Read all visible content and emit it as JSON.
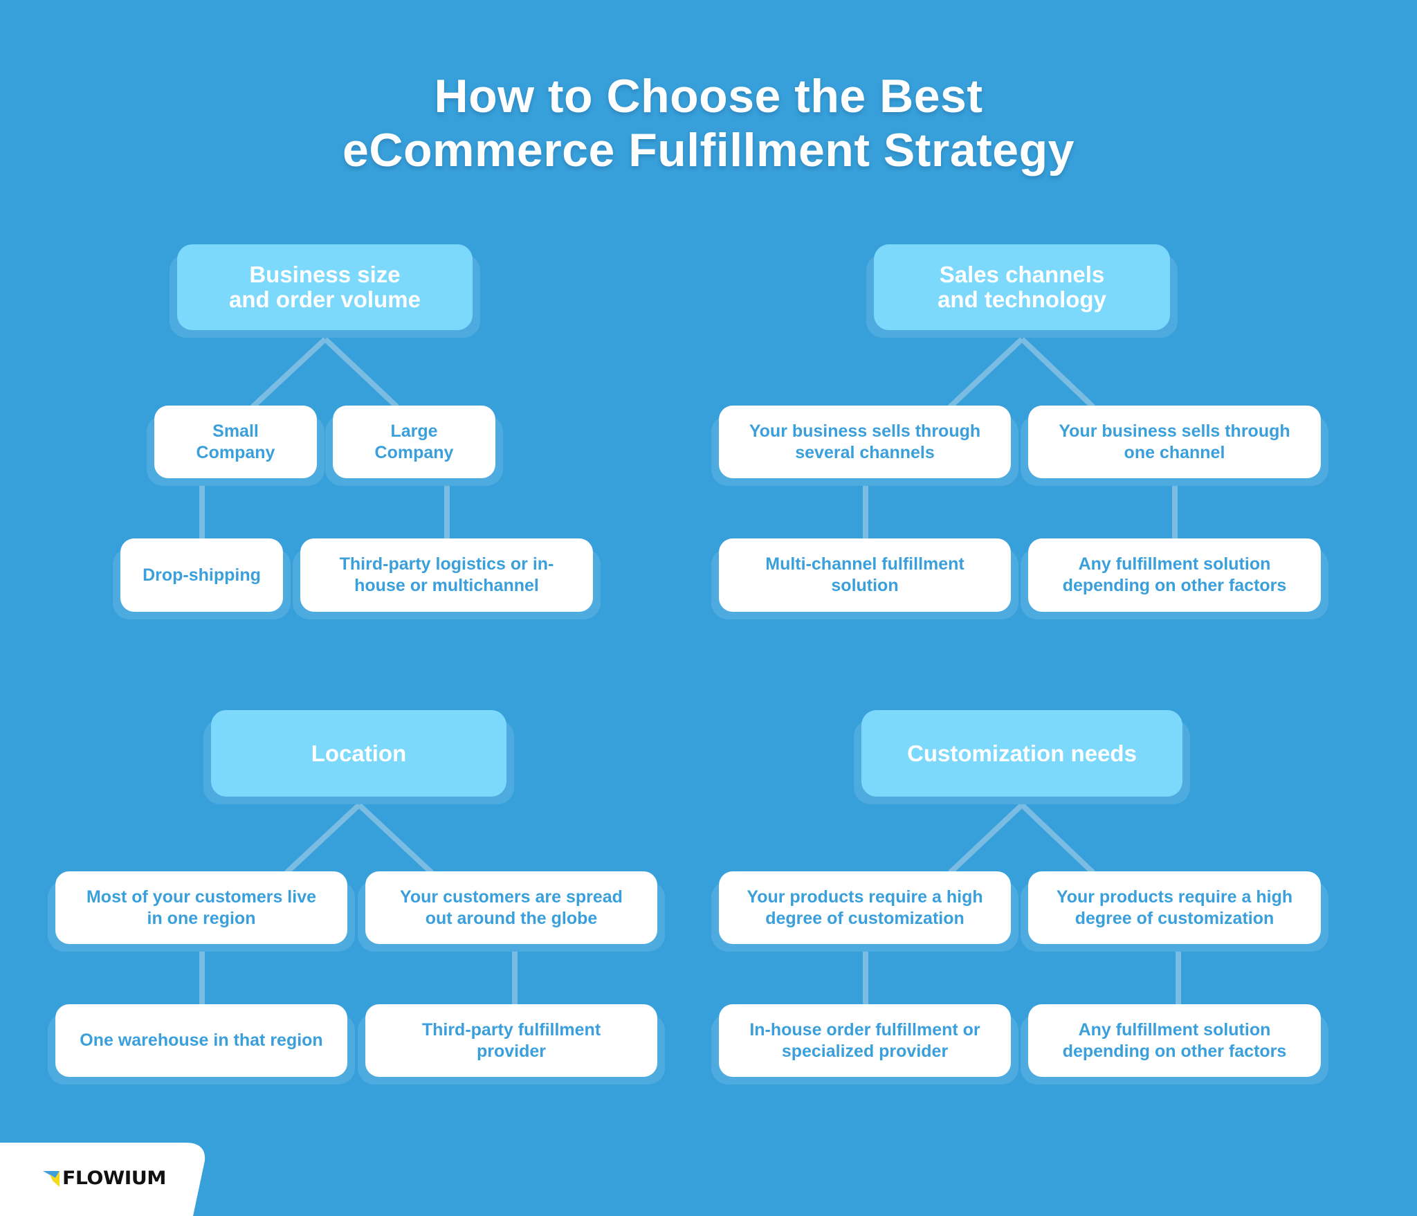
{
  "title": {
    "line1": "How to Choose the Best",
    "line2": "eCommerce Fulfillment Strategy"
  },
  "colors": {
    "background": "#379FD9",
    "header_box": "#7DD9FB",
    "node_box": "#FFFFFF",
    "node_text": "#3A9FDA",
    "connector": "#7BBCE3",
    "box_shadow": "#4EABE0"
  },
  "groups": [
    {
      "header": "Business size\nand order volume",
      "options": [
        {
          "condition": "Small\nCompany",
          "result": "Drop-shipping"
        },
        {
          "condition": "Large\nCompany",
          "result": "Third-party logistics or in-\nhouse or multichannel"
        }
      ]
    },
    {
      "header": "Sales channels\nand technology",
      "options": [
        {
          "condition": "Your business sells through\nseveral channels",
          "result": "Multi-channel fulfillment\nsolution"
        },
        {
          "condition": "Your business sells through\none channel",
          "result": "Any fulfillment solution\ndepending on other factors"
        }
      ]
    },
    {
      "header": "Location",
      "options": [
        {
          "condition": "Most of your customers live\nin one region",
          "result": "One warehouse in that region"
        },
        {
          "condition": "Your customers are spread\nout around the globe",
          "result": "Third-party fulfillment\nprovider"
        }
      ]
    },
    {
      "header": "Customization needs",
      "options": [
        {
          "condition": "Your products require a high\ndegree of customization",
          "result": "In-house order fulfillment or\nspecialized provider"
        },
        {
          "condition": "Your products require a high\ndegree of customization",
          "result": "Any fulfillment solution\ndepending on other factors"
        }
      ]
    }
  ],
  "footer": {
    "brand": "FLOWIUM",
    "logo_icon": "flowium-triangle-logo-icon"
  }
}
